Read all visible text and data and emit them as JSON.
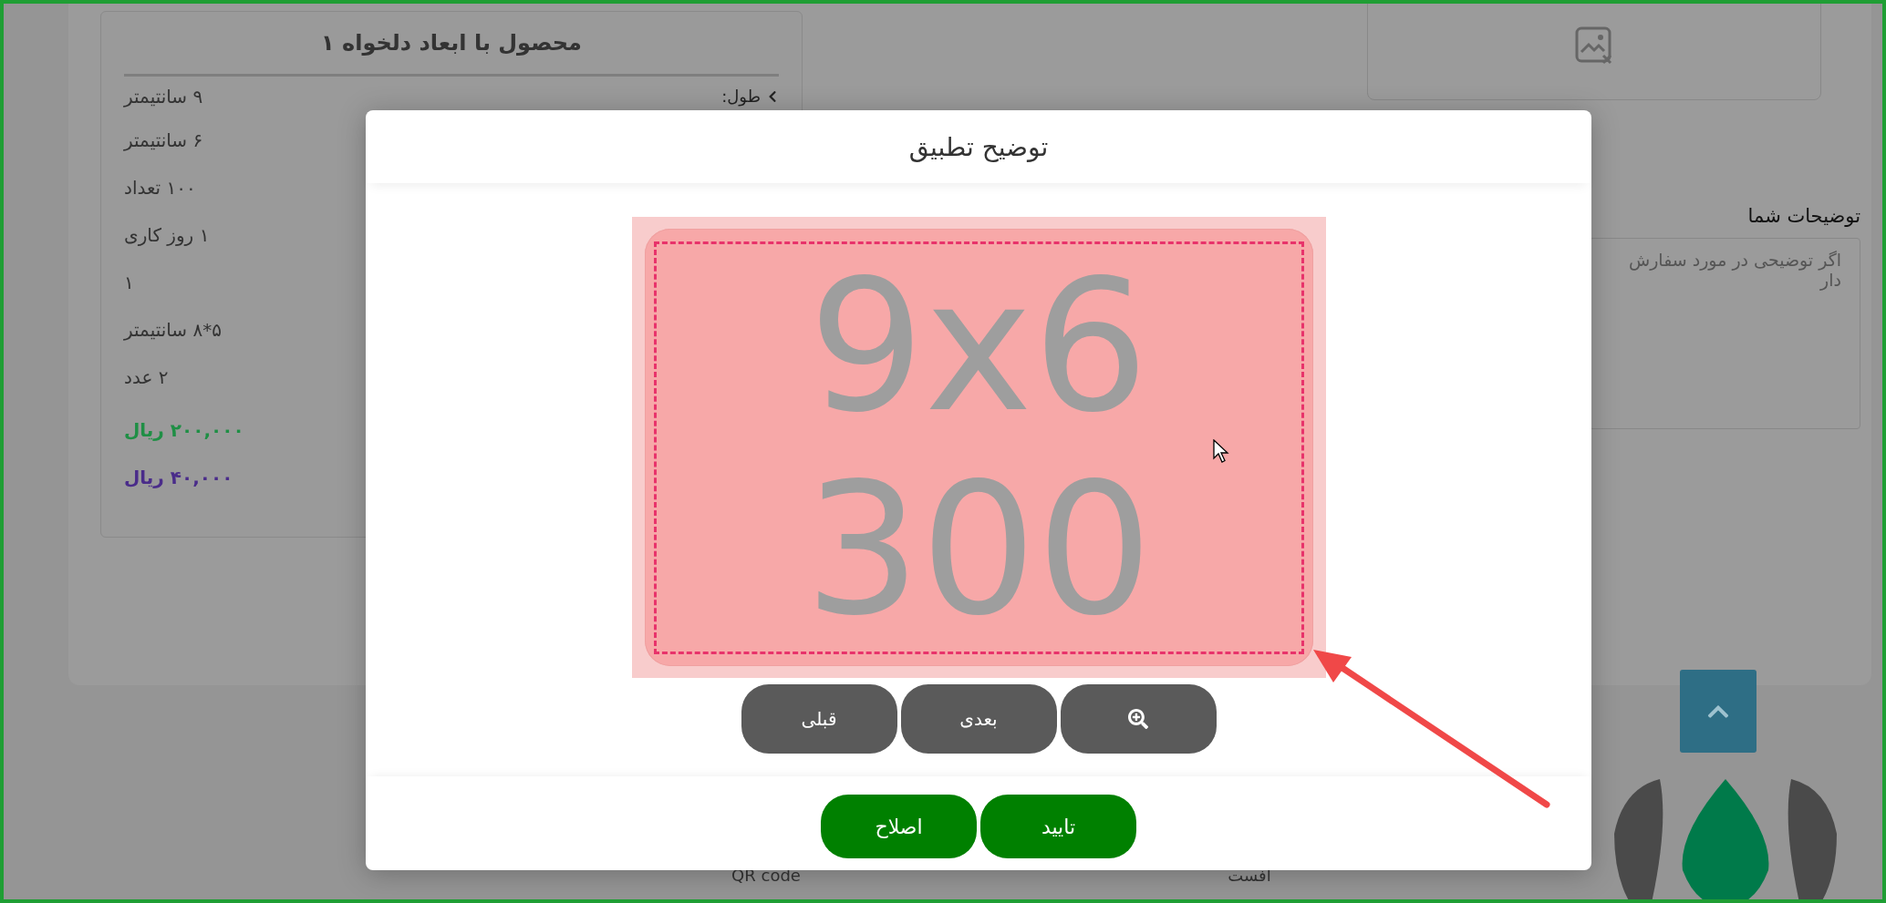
{
  "background_page": {
    "product_card": {
      "title": "محصول با ابعاد دلخواه ۱",
      "field_label": "طول:",
      "values": [
        "۹ سانتیمتر",
        "۶ سانتیمتر",
        "۱۰۰ تعداد",
        "۱ روز کاری",
        "۱",
        "۵*۸ سانتیمتر",
        "۲ عدد"
      ],
      "prices": [
        {
          "text": "۲۰۰,۰۰۰ ریال",
          "color": "#1f8f45"
        },
        {
          "text": "۴۰,۰۰۰ ریال",
          "color": "#4a2c8a"
        }
      ]
    },
    "notes": {
      "label": "توضیحات شما",
      "placeholder": "اگر توضیحی در مورد سفارش دار"
    },
    "footer": {
      "items": [
        "افست",
        "QR code"
      ]
    }
  },
  "dialog": {
    "title": "توضیح تطبیق",
    "preview": {
      "size_text": "9x6",
      "quantity_text": "300"
    },
    "nav_buttons": [
      {
        "kind": "zoom"
      },
      {
        "kind": "text",
        "label": "بعدی"
      },
      {
        "kind": "text",
        "label": "قبلی"
      }
    ],
    "actions": [
      {
        "label": "تایید"
      },
      {
        "label": "اصلاح"
      }
    ]
  }
}
